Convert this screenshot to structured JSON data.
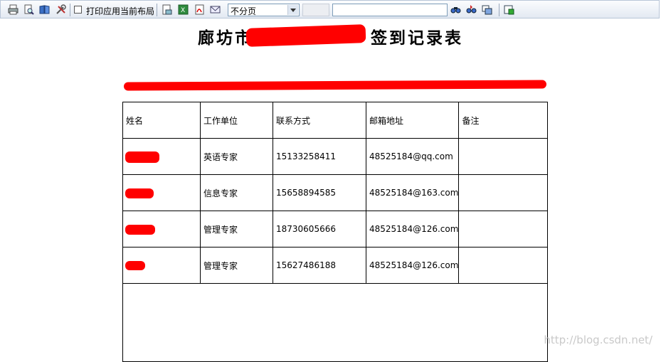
{
  "toolbar": {
    "icons": [
      "print-icon",
      "print-preview-icon",
      "book-icon",
      "tools-icon",
      "page-setup-icon",
      "excel-export-icon",
      "pdf-export-icon",
      "email-icon",
      "find-icon",
      "find-next-icon",
      "find-previous-icon",
      "export-icon"
    ],
    "print_layout_label": "打印应用当前布局",
    "paging_select_value": "不分页",
    "search_value": ""
  },
  "document": {
    "title_prefix": "廊坊市",
    "title_suffix": "签到记录表",
    "table": {
      "headers": [
        "姓名",
        "工作单位",
        "联系方式",
        "邮箱地址",
        "备注"
      ],
      "rows": [
        {
          "name": "",
          "unit": "英语专家",
          "phone": "15133258411",
          "email": "48525184@qq.com",
          "remark": ""
        },
        {
          "name": "",
          "unit": "信息专家",
          "phone": "15658894585",
          "email": "48525184@163.com",
          "remark": ""
        },
        {
          "name": "",
          "unit": "管理专家",
          "phone": "18730605666",
          "email": "48525184@126.com",
          "remark": ""
        },
        {
          "name": "",
          "unit": "管理专家",
          "phone": "15627486188",
          "email": "48525184@126.com",
          "remark": ""
        }
      ]
    }
  },
  "watermark": "http://blog.csdn.net/"
}
